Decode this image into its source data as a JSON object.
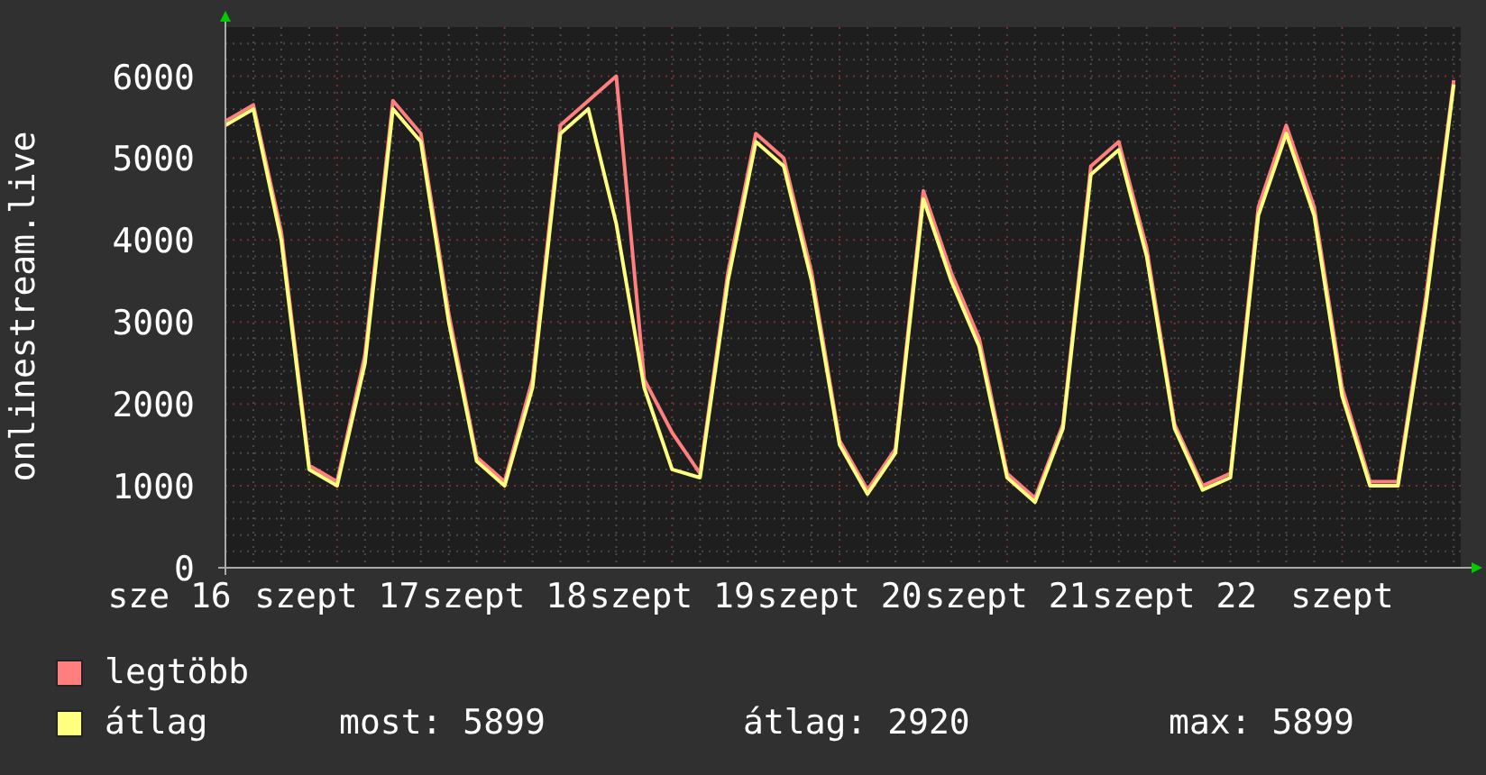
{
  "chart_data": {
    "type": "line",
    "ylabel": "onlinestream.live",
    "grid": true,
    "categories": [
      "sze 16",
      null,
      null,
      null,
      null,
      null,
      "szept 17",
      null,
      null,
      null,
      null,
      null,
      "szept 18",
      null,
      null,
      null,
      null,
      null,
      "szept 19",
      null,
      null,
      null,
      null,
      null,
      "szept 20",
      null,
      null,
      null,
      null,
      null,
      "szept 21",
      null,
      null,
      null,
      null,
      null,
      "szept 22",
      null,
      null,
      null,
      null,
      null,
      "szept",
      null,
      null,
      null,
      null
    ],
    "series": [
      {
        "name": "legtöbb",
        "color": "#ff7f7f",
        "values": [
          null,
          null,
          5450,
          5650,
          4100,
          1250,
          1050,
          2600,
          5700,
          5300,
          3100,
          1350,
          1050,
          2300,
          5400,
          5700,
          6000,
          2300,
          1650,
          1150,
          3600,
          5300,
          5000,
          3600,
          1550,
          950,
          1450,
          4600,
          3600,
          2800,
          1150,
          850,
          1750,
          4900,
          5200,
          3900,
          1750,
          1000,
          1150,
          4400,
          5400,
          4400,
          2200,
          1050,
          1050,
          3300,
          5950
        ]
      },
      {
        "name": "átlag",
        "color": "#ffff80",
        "values": [
          null,
          null,
          5400,
          5600,
          4000,
          1200,
          1000,
          2500,
          5600,
          5200,
          3000,
          1300,
          1000,
          2200,
          5300,
          5600,
          4200,
          2200,
          1200,
          1100,
          3500,
          5200,
          4900,
          3500,
          1500,
          900,
          1400,
          4500,
          3500,
          2700,
          1100,
          800,
          1700,
          4800,
          5100,
          3800,
          1700,
          950,
          1100,
          4300,
          5300,
          4300,
          2100,
          1000,
          1000,
          3200,
          5900
        ]
      }
    ],
    "ylim": [
      0,
      6600
    ],
    "yticks": [
      0,
      1000,
      2000,
      3000,
      4000,
      5000,
      6000
    ]
  },
  "summary": [
    "most: 5899",
    "átlag: 2920",
    "max: 5899"
  ]
}
